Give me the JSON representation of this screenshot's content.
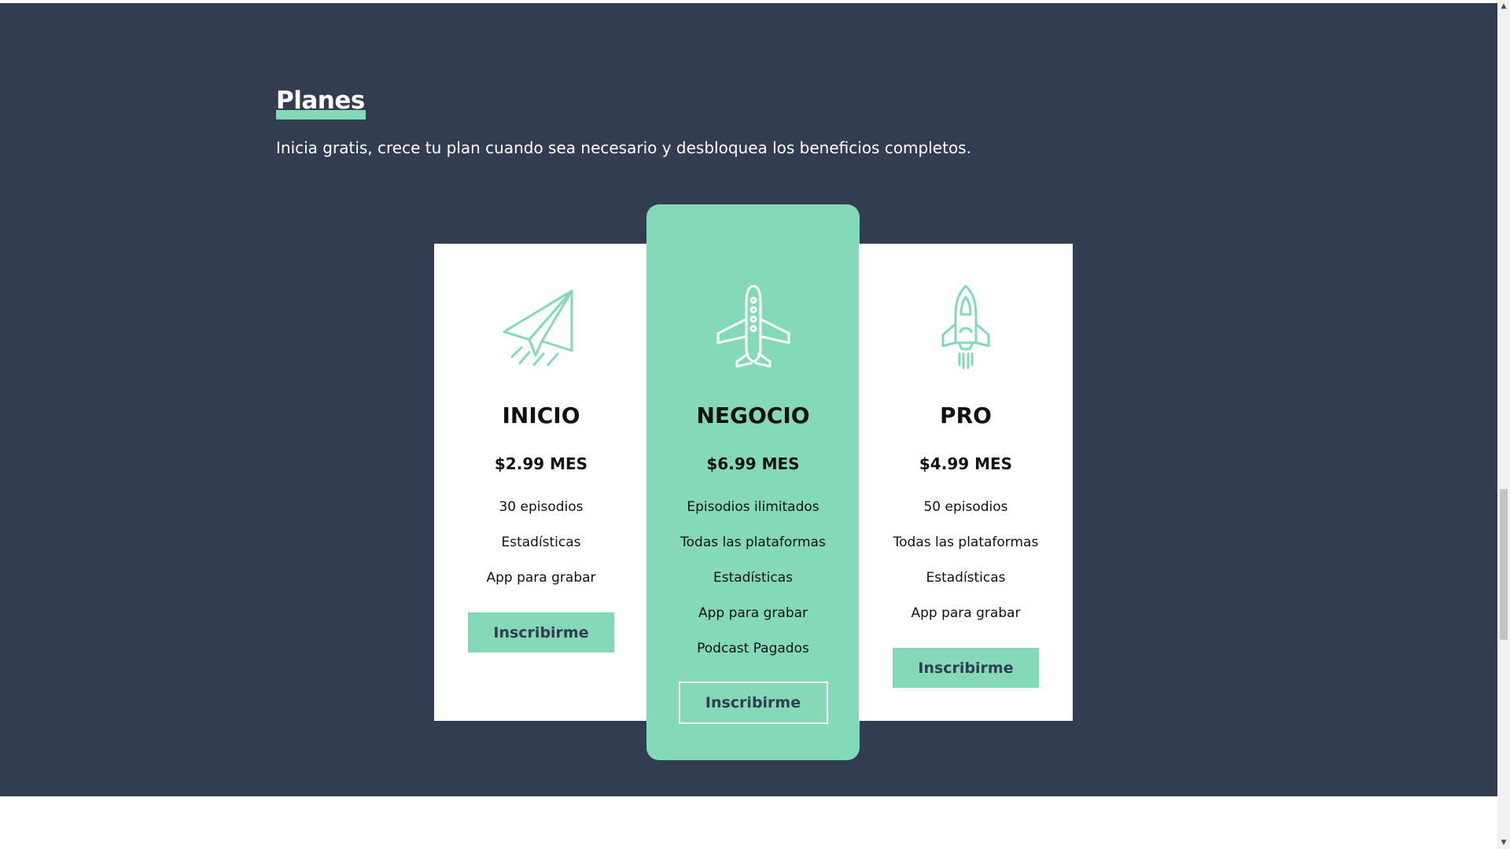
{
  "header": {
    "title": "Planes",
    "subtitle": "Inicia gratis, crece tu plan cuando sea necesario y desbloquea los beneficios completos."
  },
  "plans": [
    {
      "icon": "paper-plane-icon",
      "name": "INICIO",
      "price": "$2.99 MES",
      "features": [
        "30 episodios",
        "Estadísticas",
        "App para grabar"
      ],
      "button": "Inscribirme"
    },
    {
      "icon": "airplane-icon",
      "name": "NEGOCIO",
      "price": "$6.99 MES",
      "features": [
        "Episodios ilimitados",
        "Todas las plataformas",
        "Estadísticas",
        "App para grabar",
        "Podcast Pagados"
      ],
      "button": "Inscribirme"
    },
    {
      "icon": "space-shuttle-icon",
      "name": "PRO",
      "price": "$4.99 MES",
      "features": [
        "50 episodios",
        "Todas las plataformas",
        "Estadísticas",
        "App para grabar"
      ],
      "button": "Inscribirme"
    }
  ],
  "colors": {
    "section_background": "#323d51",
    "accent": "#84d9b9",
    "card_background": "#ffffff",
    "button_text": "#323d51"
  }
}
